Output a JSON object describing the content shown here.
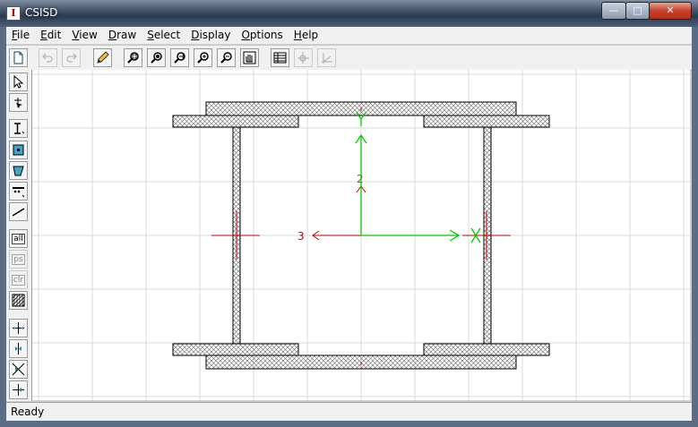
{
  "window": {
    "title": "CSISD"
  },
  "menu": [
    {
      "label": "File",
      "underline": "F",
      "rest": "ile"
    },
    {
      "label": "Edit",
      "underline": "E",
      "rest": "dit"
    },
    {
      "label": "View",
      "underline": "V",
      "rest": "iew"
    },
    {
      "label": "Draw",
      "underline": "D",
      "rest": "raw"
    },
    {
      "label": "Select",
      "underline": "S",
      "rest": "elect"
    },
    {
      "label": "Display",
      "underline": "D",
      "rest": "isplay"
    },
    {
      "label": "Options",
      "underline": "O",
      "rest": "ptions"
    },
    {
      "label": "Help",
      "underline": "H",
      "rest": "elp"
    }
  ],
  "toolbar": [
    "new-file-icon",
    "undo-icon",
    "redo-icon",
    "pencil-icon",
    "zoom-window-icon",
    "zoom-extents-icon",
    "zoom-in-icon",
    "zoom-plus-icon",
    "zoom-out-icon",
    "pan-hand-icon",
    "table-icon",
    "axis-cross-icon",
    "angle-icon"
  ],
  "left_tools": {
    "labels": {
      "all": "all",
      "ps": "ps",
      "clr": "clr"
    }
  },
  "canvas": {
    "axis_labels": {
      "axis2": "2",
      "axis3": "3"
    },
    "colors": {
      "grid": "#d8d8d8",
      "section": "#000000",
      "hatch": "#6a6a6a",
      "local_axis": "#cc0000",
      "principal_axis": "#00cc00"
    }
  },
  "status": {
    "text": "Ready"
  }
}
